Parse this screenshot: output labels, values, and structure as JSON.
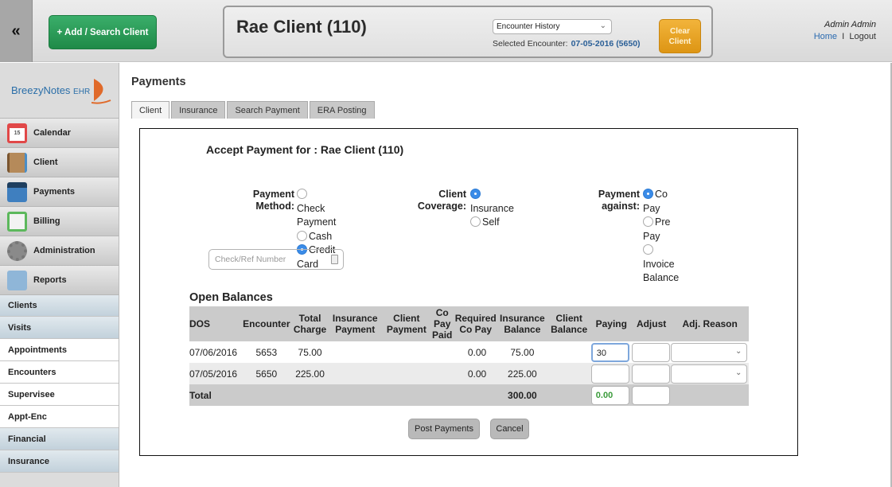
{
  "topbar": {
    "collapse_icon": "double-chevron-left-icon",
    "collapse_glyph": "«",
    "add_search_label": "+ Add / Search Client",
    "client_name": "Rae Client (110)",
    "encounter_select": {
      "value": "Encounter History",
      "chevron": "»"
    },
    "selected_encounter_label": "Selected Encounter:",
    "selected_encounter_value": "07-05-2016 (5650)",
    "clear_client_label_1": "Clear",
    "clear_client_label_2": "Client",
    "user_name": "Admin Admin",
    "home_link": "Home",
    "separator": "I",
    "logout_link": "Logout"
  },
  "sidebar": {
    "logo_text": "BreezyNotes",
    "logo_suffix": "EHR",
    "nav": [
      {
        "label": "Calendar",
        "icon": "calendar-icon"
      },
      {
        "label": "Client",
        "icon": "address-book-icon"
      },
      {
        "label": "Payments",
        "icon": "credit-card-icon"
      },
      {
        "label": "Billing",
        "icon": "clipboard-icon"
      },
      {
        "label": "Administration",
        "icon": "gear-icon"
      },
      {
        "label": "Reports",
        "icon": "chart-icon"
      }
    ],
    "subnav": [
      {
        "label": "Clients"
      },
      {
        "label": "Visits"
      },
      {
        "label": "Appointments"
      },
      {
        "label": "Encounters"
      },
      {
        "label": "Supervisee"
      },
      {
        "label": "Appt-Enc"
      },
      {
        "label": "Financial"
      },
      {
        "label": "Insurance"
      }
    ]
  },
  "main": {
    "title": "Payments",
    "tabs": [
      {
        "label": "Client",
        "active": true
      },
      {
        "label": "Insurance"
      },
      {
        "label": "Search Payment"
      },
      {
        "label": "ERA Posting"
      }
    ],
    "accept_label": "Accept Payment for :  Rae Client (110)",
    "payment_method": {
      "label_1": "Payment",
      "label_2": "Method:",
      "options": [
        "Check",
        "Payment",
        "Cash",
        "Credit Card"
      ],
      "selected": "Credit Card"
    },
    "client_coverage": {
      "label_1": "Client",
      "label_2": "Coverage:",
      "options": [
        "Insurance",
        "Self"
      ],
      "selected": "Insurance"
    },
    "payment_against": {
      "label_1": "Payment",
      "label_2": "against:",
      "options": [
        "Co Pay",
        "Pre Pay",
        "Invoice",
        "Balance"
      ],
      "selected": "Co Pay"
    },
    "ref_placeholder": "Check/Ref Number",
    "open_balances": {
      "title": "Open Balances",
      "headers": {
        "dos": "DOS",
        "encounter": "Encounter",
        "total_charge_1": "Total",
        "total_charge_2": "Charge",
        "ins_payment_1": "Insurance",
        "ins_payment_2": "Payment",
        "client_payment_1": "Client",
        "client_payment_2": "Payment",
        "copay_paid_1": "Co",
        "copay_paid_2": "Pay",
        "copay_paid_3": "Paid",
        "req_copay_1": "Required",
        "req_copay_2": "Co Pay",
        "ins_balance_1": "Insurance",
        "ins_balance_2": "Balance",
        "client_balance_1": "Client",
        "client_balance_2": "Balance",
        "paying": "Paying",
        "adjust": "Adjust",
        "adj_reason": "Adj. Reason"
      },
      "rows": [
        {
          "dos": "07/06/2016",
          "encounter": "5653",
          "total_charge": "75.00",
          "ins_payment": "",
          "client_payment": "",
          "copay_paid": "",
          "req_copay": "0.00",
          "ins_balance": "75.00",
          "client_balance": "",
          "paying": "30",
          "adjust": ""
        },
        {
          "dos": "07/05/2016",
          "encounter": "5650",
          "total_charge": "225.00",
          "ins_payment": "",
          "client_payment": "",
          "copay_paid": "",
          "req_copay": "0.00",
          "ins_balance": "225.00",
          "client_balance": "",
          "paying": "",
          "adjust": ""
        }
      ],
      "total": {
        "label": "Total",
        "ins_balance": "300.00",
        "paying": "0.00",
        "adjust": ""
      }
    },
    "post_button": "Post Payments",
    "cancel_button": "Cancel"
  }
}
